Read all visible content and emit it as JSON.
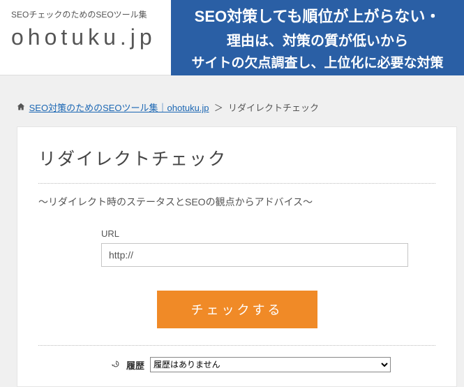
{
  "header": {
    "tagline": "SEOチェックのためのSEOツール集",
    "logo": "ohotuku.jp",
    "banner": {
      "line1": "SEO対策しても順位が上がらない・",
      "line2": "理由は、対策の質が低いから",
      "line3": "サイトの欠点調査し、上位化に必要な対策"
    }
  },
  "breadcrumb": {
    "home_link": "SEO対策のためのSEOツール集｜ohotuku.jp",
    "separator": "＞",
    "current": "リダイレクトチェック"
  },
  "card": {
    "title": "リダイレクトチェック",
    "subtitle": "～リダイレクト時のステータスとSEOの観点からアドバイス～",
    "url_label": "URL",
    "url_value": "http://",
    "submit_label": "チェックする",
    "history_label": "履歴",
    "history_selected": "履歴はありません"
  }
}
